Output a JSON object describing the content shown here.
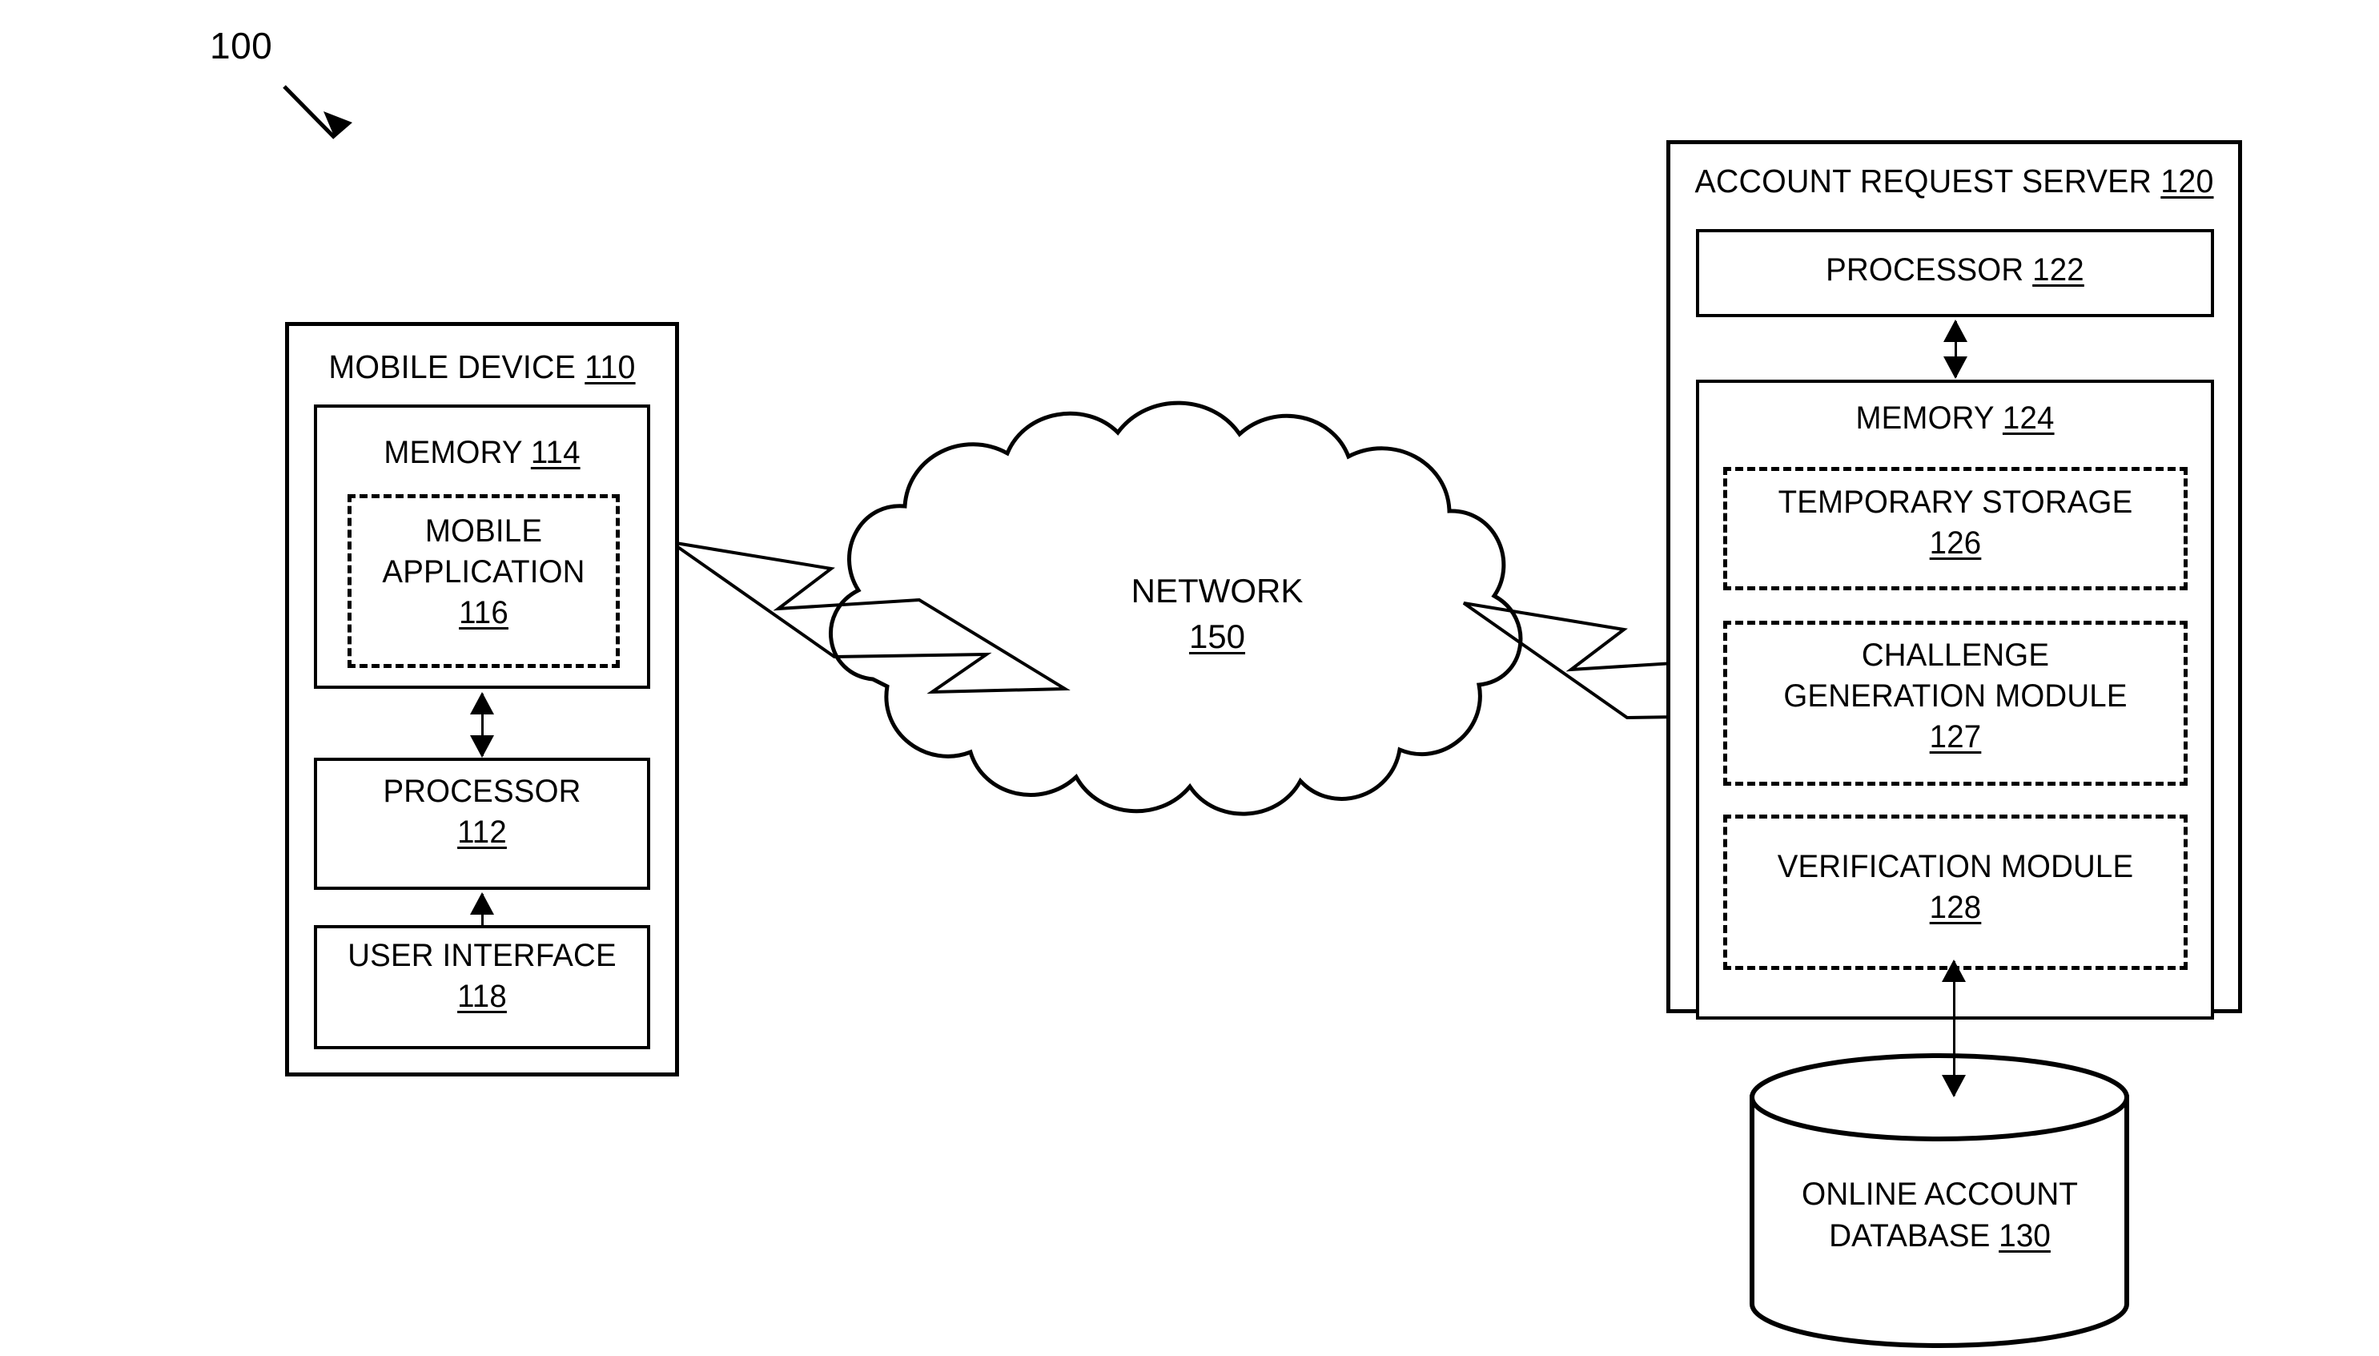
{
  "figure": {
    "number": "100"
  },
  "mobile_device": {
    "title": "MOBILE DEVICE",
    "ref": "110",
    "memory": {
      "title": "MEMORY",
      "ref": "114",
      "application": {
        "title": "MOBILE\nAPPLICATION",
        "ref": "116"
      }
    },
    "processor": {
      "title": "PROCESSOR",
      "ref": "112"
    },
    "user_interface": {
      "title": "USER INTERFACE",
      "ref": "118"
    }
  },
  "network": {
    "title": "NETWORK",
    "ref": "150"
  },
  "server": {
    "title": "ACCOUNT REQUEST SERVER",
    "ref": "120",
    "processor": {
      "title": "PROCESSOR",
      "ref": "122"
    },
    "memory": {
      "title": "MEMORY",
      "ref": "124",
      "modules": [
        {
          "title": "TEMPORARY STORAGE",
          "ref": "126"
        },
        {
          "title": "CHALLENGE\nGENERATION MODULE",
          "ref": "127"
        },
        {
          "title": "VERIFICATION MODULE",
          "ref": "128"
        }
      ]
    }
  },
  "database": {
    "title": "ONLINE ACCOUNT\nDATABASE",
    "ref": "130"
  },
  "colors": {
    "stroke": "#000000",
    "background": "#ffffff"
  },
  "connectors": {
    "mobile_to_network": "lightning-bolt",
    "network_to_server": "lightning-bolt",
    "memory_processor": "double-arrow",
    "processor_ui": "double-arrow",
    "server_processor_memory": "double-arrow",
    "memory_database": "double-arrow"
  }
}
